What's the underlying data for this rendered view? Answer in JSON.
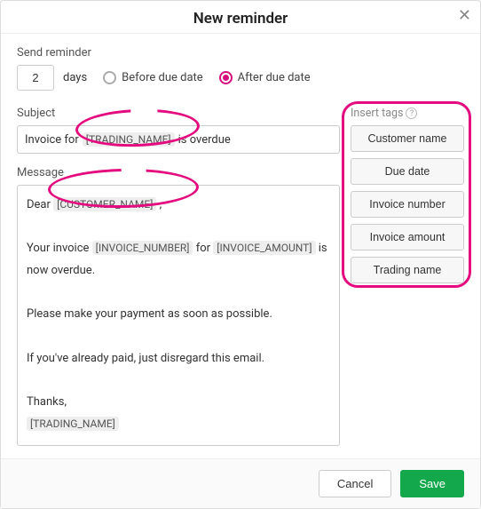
{
  "header": {
    "title": "New reminder",
    "close": "✕"
  },
  "send": {
    "label": "Send reminder",
    "days_value": "2",
    "days_text": "days",
    "before_label": "Before due date",
    "after_label": "After due date"
  },
  "subject": {
    "label": "Subject",
    "pre": "Invoice for",
    "tag": "[TRADING_NAME]",
    "post": "is overdue"
  },
  "message": {
    "label": "Message",
    "l1a": "Dear",
    "l1tag": "[CUSTOMER_NAME]",
    "l1b": ",",
    "l2a": "Your invoice",
    "l2tag1": "[INVOICE_NUMBER]",
    "l2b": "for",
    "l2tag2": "[INVOICE_AMOUNT]",
    "l2c": "is now overdue.",
    "l3": "Please make your payment as soon as possible.",
    "l4": "If you've already paid, just disregard this email.",
    "l5": "Thanks,",
    "l5tag": "[TRADING_NAME]"
  },
  "insert": {
    "label": "Insert tags",
    "help": "?",
    "tags": [
      "Customer name",
      "Due date",
      "Invoice number",
      "Invoice amount",
      "Trading name"
    ]
  },
  "footer": {
    "cancel": "Cancel",
    "save": "Save"
  }
}
